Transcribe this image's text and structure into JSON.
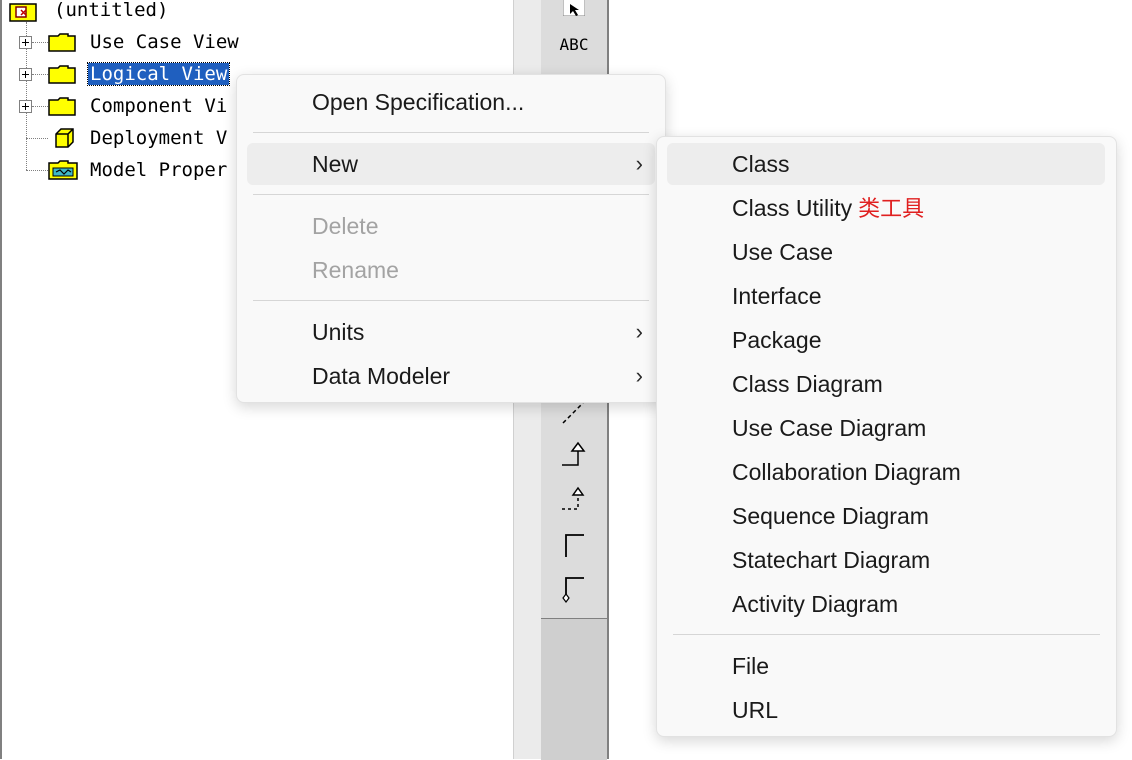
{
  "tree": {
    "root": "(untitled)",
    "items": [
      {
        "label": "Use Case View"
      },
      {
        "label": "Logical View"
      },
      {
        "label": "Component Vi"
      },
      {
        "label": "Deployment V"
      },
      {
        "label": "Model Proper"
      }
    ]
  },
  "toolbox": {
    "text_tool": "ABC"
  },
  "context_menu": {
    "items": [
      {
        "label": "Open Specification..."
      },
      {
        "label": "New"
      },
      {
        "label": "Delete"
      },
      {
        "label": "Rename"
      },
      {
        "label": "Units"
      },
      {
        "label": "Data Modeler"
      }
    ]
  },
  "submenu_new": {
    "items": [
      {
        "label": "Class"
      },
      {
        "label": "Class Utility",
        "annotation": "类工具"
      },
      {
        "label": "Use Case"
      },
      {
        "label": "Interface"
      },
      {
        "label": "Package"
      },
      {
        "label": "Class Diagram"
      },
      {
        "label": "Use Case Diagram"
      },
      {
        "label": "Collaboration Diagram"
      },
      {
        "label": "Sequence Diagram"
      },
      {
        "label": "Statechart Diagram"
      },
      {
        "label": "Activity Diagram"
      },
      {
        "label": "File"
      },
      {
        "label": "URL"
      }
    ]
  },
  "colors": {
    "selection": "#1f5fbf",
    "folder": "#ffff00",
    "annotation": "#e02020",
    "menu_background": "#f9f9f9"
  }
}
